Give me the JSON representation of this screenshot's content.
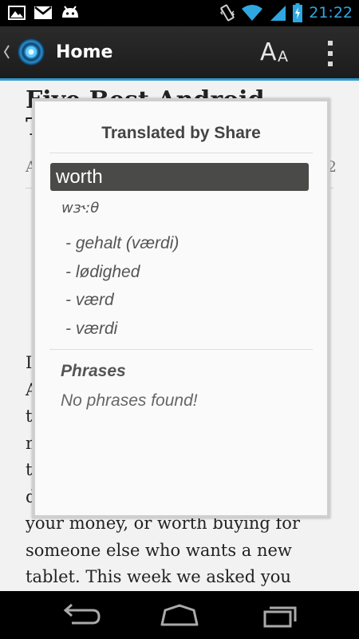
{
  "status_bar": {
    "time": "21:22",
    "left_icons": [
      "gallery-icon",
      "gmail-icon",
      "android-icon"
    ],
    "right_icons": [
      "vibrate-icon",
      "wifi-icon",
      "signal-icon",
      "battery-charging-icon"
    ],
    "time_color": "#2fa7e0"
  },
  "action_bar": {
    "title": "Home",
    "font_size_big": "A",
    "font_size_small": "A",
    "icons": [
      "up-caret-icon",
      "app-logo-icon",
      "font-size-icon",
      "overflow-menu-icon"
    ],
    "accent_color": "#2d9ccf"
  },
  "article": {
    "title_lines": [
      "Five Best Android",
      "T"
    ],
    "meta_left": "A",
    "meta_right": "2",
    "paragraph_lines": [
      "If",
      "A",
      "th",
      "m",
      "th",
      "d",
      "your money, or worth buying for",
      "someone else who wants a new",
      "tablet. This week we asked you"
    ]
  },
  "dialog": {
    "title": "Translated by Share",
    "word": "worth",
    "phonetic": "wɜ˞ːθ",
    "meanings": [
      "- gehalt (værdi)",
      "- lødighed",
      "- værd",
      "- værdi"
    ],
    "phrases_heading": "Phrases",
    "phrases_empty": "No phrases found!"
  },
  "nav_bar": {
    "icons": [
      "back-icon",
      "home-icon",
      "recent-apps-icon"
    ]
  }
}
